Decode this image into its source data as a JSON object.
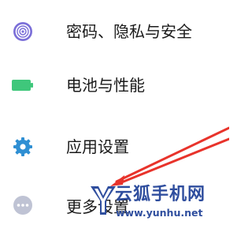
{
  "settings": {
    "items": [
      {
        "label": "密码、隐私与安全",
        "icon": "fingerprint-icon",
        "color": "#7b6fd8"
      },
      {
        "label": "电池与性能",
        "icon": "battery-icon",
        "color": "#3fc77b"
      },
      {
        "label": "应用设置",
        "icon": "gear-icon",
        "color": "#2f8fd3"
      },
      {
        "label": "更多设置",
        "icon": "more-dots-icon",
        "color": "#bfc3d4"
      }
    ]
  },
  "annotation": {
    "arrow_color": "#e8332b"
  },
  "watermark": {
    "title": "云狐手机网",
    "url": "www.yunhu.net",
    "color": "#2f4e9e"
  }
}
